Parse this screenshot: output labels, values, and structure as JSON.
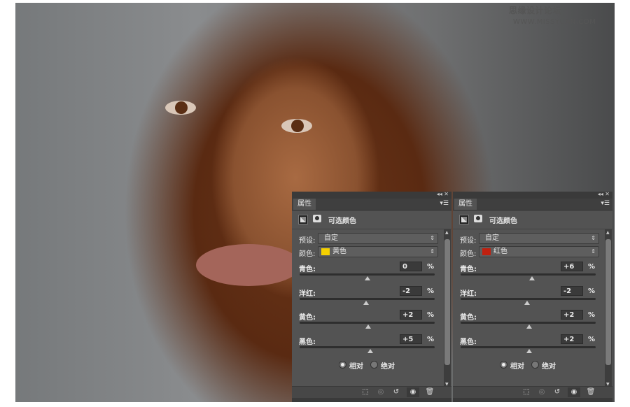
{
  "watermark": {
    "cn": "思缘设计论坛",
    "url": "WWW.MISSYUAN.COM"
  },
  "panels": [
    {
      "tab": "属性",
      "title": "可选颜色",
      "preset_label": "预设:",
      "preset_value": "自定",
      "color_label": "颜色:",
      "color_value": "黄色",
      "swatch": "#f5d000",
      "sliders": [
        {
          "label": "青色:",
          "value": "0",
          "num": 0
        },
        {
          "label": "洋红:",
          "value": "-2",
          "num": -2
        },
        {
          "label": "黄色:",
          "value": "+2",
          "num": 2
        },
        {
          "label": "黑色:",
          "value": "+5",
          "num": 5
        }
      ],
      "pct": "%",
      "relative": "相对",
      "absolute": "绝对"
    },
    {
      "tab": "属性",
      "title": "可选颜色",
      "preset_label": "预设:",
      "preset_value": "自定",
      "color_label": "颜色:",
      "color_value": "红色",
      "swatch": "#c0200f",
      "sliders": [
        {
          "label": "青色:",
          "value": "+6",
          "num": 6
        },
        {
          "label": "洋红:",
          "value": "-2",
          "num": -2
        },
        {
          "label": "黄色:",
          "value": "+2",
          "num": 2
        },
        {
          "label": "黑色:",
          "value": "+2",
          "num": 2
        }
      ],
      "pct": "%",
      "relative": "相对",
      "absolute": "绝对"
    }
  ]
}
